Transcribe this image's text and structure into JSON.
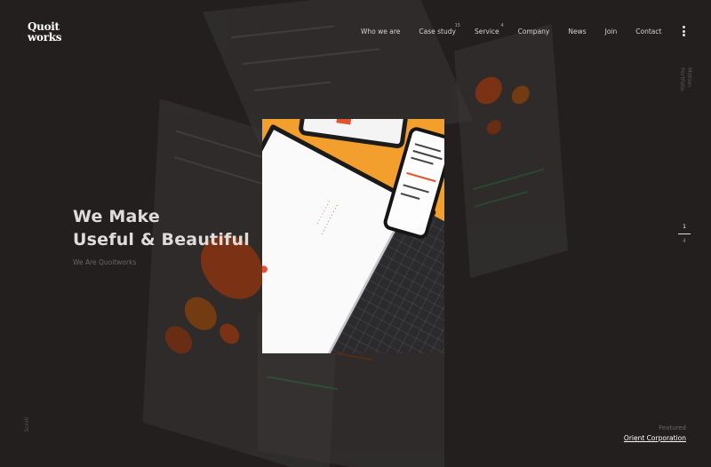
{
  "logo": {
    "line1": "Quoit",
    "line2": "works"
  },
  "nav": [
    {
      "label": "Who we are",
      "badge": ""
    },
    {
      "label": "Case study",
      "badge": "15"
    },
    {
      "label": "Service",
      "badge": "4"
    },
    {
      "label": "Company",
      "badge": ""
    },
    {
      "label": "News",
      "badge": ""
    },
    {
      "label": "Join",
      "badge": ""
    },
    {
      "label": "Contact",
      "badge": ""
    }
  ],
  "menu_icon": "vertical-dots-icon",
  "hero": {
    "line1": "We Make",
    "line2": "Useful & Beautiful",
    "sub": "We Are Quoitworks"
  },
  "side_tabs": [
    "Motion",
    "Portfolio"
  ],
  "pager": {
    "current": "1",
    "total": "4"
  },
  "scroll_label": "Scroll",
  "featured": {
    "label": "Featured",
    "link": "Orient Corporation"
  },
  "colors": {
    "background": "#231f1f",
    "accent": "#f29f2e",
    "text": "#e7e3e3"
  }
}
